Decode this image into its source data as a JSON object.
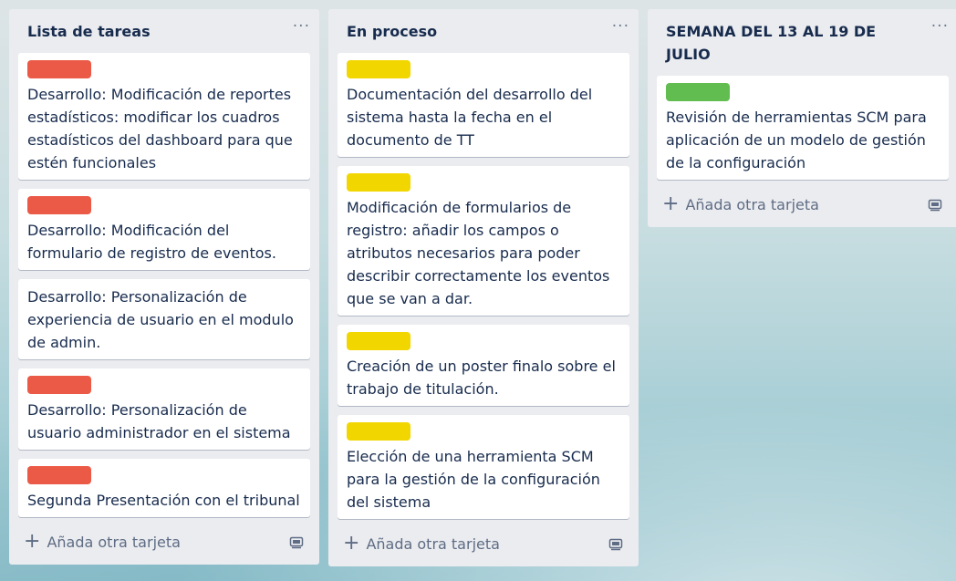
{
  "colors": {
    "red_label": "#eb5a46",
    "yellow_label": "#f2d600",
    "green_label": "#61bd4f"
  },
  "lists": [
    {
      "title": "Lista de tareas",
      "menu": "···",
      "add_card_label": "Añada otra tarjeta",
      "cards": [
        {
          "label_color": "red",
          "text": "Desarrollo: Modificación de reportes estadísticos: modificar los cuadros estadísticos del dashboard para que estén funcionales"
        },
        {
          "label_color": "red",
          "text": "Desarrollo: Modificación del formulario de registro de eventos."
        },
        {
          "label_color": null,
          "text": "Desarrollo: Personalización de experiencia de usuario en el modulo de admin."
        },
        {
          "label_color": "red",
          "text": "Desarrollo: Personalización de usuario administrador en el sistema"
        },
        {
          "label_color": "red",
          "text": "Segunda Presentación con el tribunal"
        }
      ]
    },
    {
      "title": "En proceso",
      "menu": "···",
      "add_card_label": "Añada otra tarjeta",
      "cards": [
        {
          "label_color": "yellow",
          "text": "Documentación del desarrollo del sistema hasta la fecha en el documento de TT"
        },
        {
          "label_color": "yellow",
          "text": "Modificación de formularios de registro: añadir los campos o atributos necesarios para poder describir correctamente los eventos que se van a dar."
        },
        {
          "label_color": "yellow",
          "text": "Creación de un poster finalo sobre el trabajo de titulación."
        },
        {
          "label_color": "yellow",
          "text": "Elección de una herramienta SCM para la gestión de la configuración del sistema"
        }
      ]
    },
    {
      "title": "SEMANA DEL 13 AL 19 DE JULIO",
      "menu": "···",
      "add_card_label": "Añada otra tarjeta",
      "cards": [
        {
          "label_color": "green",
          "text": "Revisión de herramientas SCM para aplicación de un modelo de gestión de la configuración"
        }
      ]
    }
  ]
}
